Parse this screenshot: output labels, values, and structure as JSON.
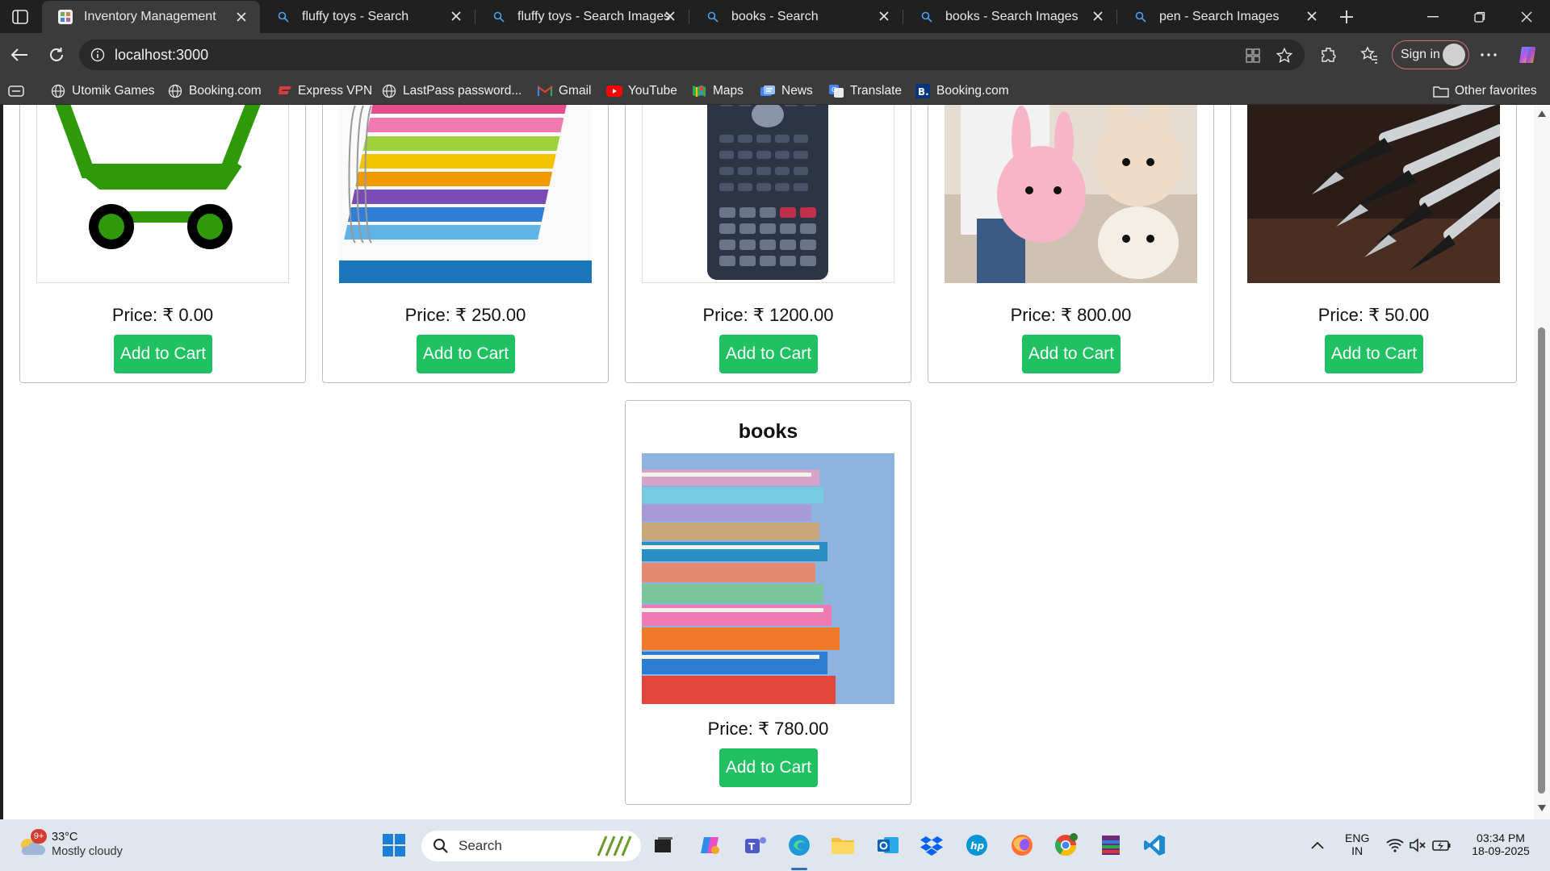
{
  "tabs": [
    {
      "title": "Inventory Management",
      "active": true
    },
    {
      "title": "fluffy toys - Search",
      "active": false
    },
    {
      "title": "fluffy toys - Search Images",
      "active": false
    },
    {
      "title": "books - Search",
      "active": false
    },
    {
      "title": "books - Search Images",
      "active": false
    },
    {
      "title": "pen - Search Images",
      "active": false
    }
  ],
  "address": {
    "url": "localhost:3000",
    "signin_label": "Sign in"
  },
  "favorites": [
    {
      "label": "Utomik Games",
      "icon": "globe-icon"
    },
    {
      "label": "Booking.com",
      "icon": "globe-icon"
    },
    {
      "label": "Express VPN",
      "icon": "expressvpn-icon"
    },
    {
      "label": "LastPass password...",
      "icon": "globe-icon"
    },
    {
      "label": "Gmail",
      "icon": "gmail-icon"
    },
    {
      "label": "YouTube",
      "icon": "youtube-icon"
    },
    {
      "label": "Maps",
      "icon": "maps-icon"
    },
    {
      "label": "News",
      "icon": "news-icon"
    },
    {
      "label": "Translate",
      "icon": "translate-icon"
    },
    {
      "label": "Booking.com",
      "icon": "booking-icon"
    }
  ],
  "other_favorites": "Other favorites",
  "products": [
    {
      "name": "",
      "price": "Price: ₹ 0.00",
      "button": "Add to Cart",
      "image": "cart-image"
    },
    {
      "name": "",
      "price": "Price: ₹ 250.00",
      "button": "Add to Cart",
      "image": "notebooks-image"
    },
    {
      "name": "",
      "price": "Price: ₹ 1200.00",
      "button": "Add to Cart",
      "image": "calculator-image"
    },
    {
      "name": "",
      "price": "Price: ₹ 800.00",
      "button": "Add to Cart",
      "image": "fluffy-toys-image"
    },
    {
      "name": "",
      "price": "Price: ₹ 50.00",
      "button": "Add to Cart",
      "image": "pens-image"
    },
    {
      "name": "books",
      "price": "Price: ₹ 780.00",
      "button": "Add to Cart",
      "image": "books-image"
    }
  ],
  "taskbar": {
    "weather_temp": "33°C",
    "weather_desc": "Mostly cloudy",
    "weather_badge": "9+",
    "search_label": "Search",
    "lang_top": "ENG",
    "lang_bottom": "IN",
    "time": "03:34 PM",
    "date": "18-09-2025"
  },
  "colors": {
    "add_to_cart": "#1fc163",
    "browser_dark": "#202020",
    "browser_toolbar": "#3b3b3b",
    "taskbar": "#dfe6ee"
  }
}
